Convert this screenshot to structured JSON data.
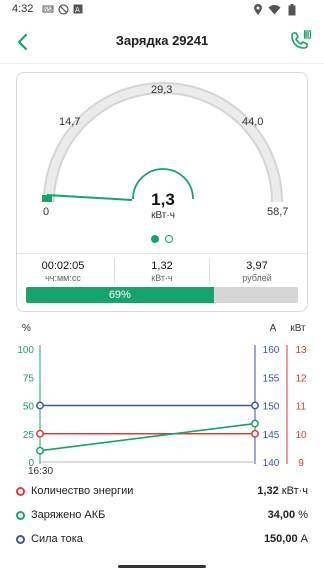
{
  "status_bar": {
    "time": "4:32",
    "icons": [
      "notification-icon",
      "nfc-icon",
      "blocked-icon",
      "app-a-icon",
      "location-icon",
      "wifi-icon",
      "battery-icon"
    ]
  },
  "app_bar": {
    "title": "Зарядка 29241",
    "back_icon": "back-arrow-icon",
    "action_icon": "phone-icon"
  },
  "colors": {
    "accent": "#17a46b",
    "energy": "#e53935",
    "battery": "#17a46b",
    "current": "#3f51b5",
    "gauge_track": "#dcdcdc"
  },
  "gauge": {
    "min_label": "0",
    "max_label": "58,7",
    "ticks": [
      "14,7",
      "29,3",
      "44,0"
    ],
    "value": 1.3,
    "max": 58.7,
    "value_text": "1,3",
    "unit": "кВт·ч",
    "page_dots": [
      true,
      false
    ]
  },
  "stats": [
    {
      "value": "00:02:05",
      "unit": "чч:мм:сс"
    },
    {
      "value": "1,32",
      "unit": "кВт·ч"
    },
    {
      "value": "3,97",
      "unit": "рублей"
    }
  ],
  "progress": {
    "percent": 69,
    "label": "69%"
  },
  "chart_data": {
    "type": "line",
    "x_start_label": "16:30",
    "left_axis": {
      "label": "%",
      "ticks": [
        "100",
        "75",
        "50",
        "25",
        "0"
      ],
      "range": [
        0,
        100
      ]
    },
    "mid_axis": {
      "label": "А",
      "ticks": [
        "160",
        "155",
        "150",
        "145",
        "140"
      ],
      "range": [
        140,
        160
      ]
    },
    "right_axis": {
      "label": "кВт",
      "ticks": [
        "13",
        "12",
        "11",
        "10",
        "9"
      ],
      "range": [
        9,
        13
      ]
    },
    "grid": false,
    "series": [
      {
        "name": "Количество энергии",
        "axis": "right",
        "color": "#e53935",
        "points": [
          [
            0,
            10
          ],
          [
            1,
            10
          ]
        ]
      },
      {
        "name": "Заряжено АКБ",
        "axis": "left",
        "color": "#17a46b",
        "points": [
          [
            0,
            10
          ],
          [
            1,
            34
          ]
        ]
      },
      {
        "name": "Сила тока",
        "axis": "mid",
        "color": "#3f51b5",
        "points": [
          [
            0,
            150
          ],
          [
            1,
            150
          ]
        ]
      }
    ]
  },
  "legend": [
    {
      "label": "Количество энергии",
      "value": "1,32",
      "unit": "кВт·ч",
      "color": "#e53935"
    },
    {
      "label": "Заряжено АКБ",
      "value": "34,00",
      "unit": "%",
      "color": "#17a46b"
    },
    {
      "label": "Сила тока",
      "value": "150,00",
      "unit": "А",
      "color": "#3f51b5"
    }
  ]
}
